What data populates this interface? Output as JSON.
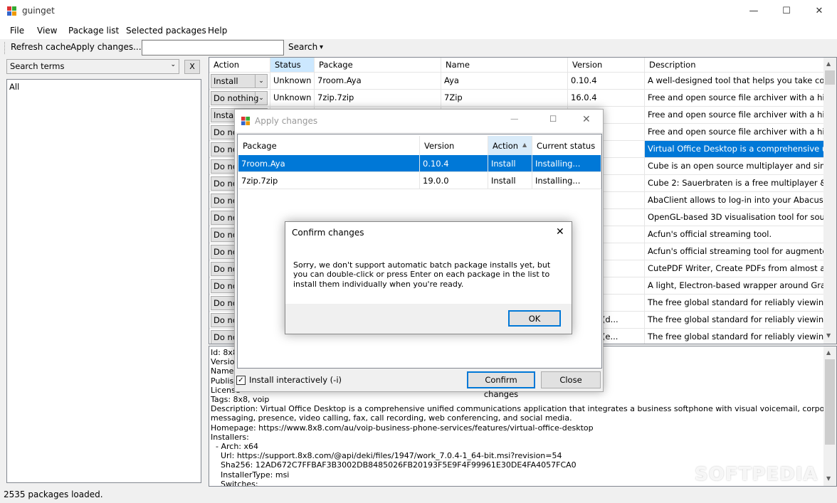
{
  "window": {
    "title": "guinget",
    "minimize": "—",
    "maximize": "☐",
    "close": "✕"
  },
  "menu": [
    "File",
    "View",
    "Package list",
    "Selected packages",
    "Help"
  ],
  "toolbar": {
    "refresh": "Refresh cache",
    "apply": "Apply changes...",
    "search_value": "",
    "search": "Search",
    "search_dropdown": "▾"
  },
  "left": {
    "search_terms": "Search terms",
    "clear": "X",
    "terms": [
      "All"
    ]
  },
  "grid": {
    "headers": [
      "Action",
      "Status",
      "Package",
      "Name",
      "Version",
      "Description"
    ],
    "rows": [
      {
        "action": "Install",
        "status": "Unknown",
        "package": "7room.Aya",
        "name": "Aya",
        "version": "0.10.4",
        "desc": "A well-designed tool that helps you take control o..."
      },
      {
        "action": "Do nothing",
        "status": "Unknown",
        "package": "7zip.7zip",
        "name": "7Zip",
        "version": "16.0.4",
        "desc": "Free and open source file archiver with a high co..."
      },
      {
        "action": "Install",
        "status": "",
        "package": "",
        "name": "",
        "version": "",
        "desc": "Free and open source file archiver with a high co..."
      },
      {
        "action": "Do not",
        "status": "",
        "package": "",
        "name": "",
        "version": "ha",
        "desc": "Free and open source file archiver with a high co..."
      },
      {
        "action": "Do not",
        "status": "",
        "package": "",
        "name": "",
        "version": "",
        "desc": "Virtual Office Desktop is a comprehensive unified..."
      },
      {
        "action": "Do not",
        "status": "",
        "package": "",
        "name": "",
        "version": "29",
        "desc": "Cube is an open source multiplayer and singlepla..."
      },
      {
        "action": "Do not",
        "status": "",
        "package": "",
        "name": "",
        "version": "04",
        "desc": "Cube 2: Sauerbraten is a free multiplayer & single..."
      },
      {
        "action": "Do not",
        "status": "",
        "package": "",
        "name": "",
        "version": "",
        "desc": "AbaClient allows to log-in into your Abacus Busin..."
      },
      {
        "action": "Do not",
        "status": "",
        "package": "",
        "name": "",
        "version": "",
        "desc": "OpenGL-based 3D visualisation tool for source c..."
      },
      {
        "action": "Do not",
        "status": "",
        "package": "",
        "name": "",
        "version": "",
        "desc": "Acfun's official streaming tool."
      },
      {
        "action": "Do not",
        "status": "",
        "package": "",
        "name": "",
        "version": "",
        "desc": "Acfun's official streaming tool for augmented realit..."
      },
      {
        "action": "Do not",
        "status": "",
        "package": "",
        "name": "",
        "version": "",
        "desc": "CutePDF Writer, Create PDFs from almost any ap..."
      },
      {
        "action": "Do not",
        "status": "",
        "package": "",
        "name": "",
        "version": "",
        "desc": "A light, Electron-based wrapper around GraphiQL."
      },
      {
        "action": "Do not",
        "status": "",
        "package": "",
        "name": "",
        "version": ".20063",
        "desc": "The free global standard for reliably viewing, printi..."
      },
      {
        "action": "Do not",
        "status": "",
        "package": "",
        "name": "",
        "version": ".20041 (d...",
        "desc": "The free global standard for reliably viewing, printi..."
      },
      {
        "action": "Do not",
        "status": "",
        "package": "",
        "name": "",
        "version": ".20041 (e...",
        "desc": "The free global standard for reliably viewing, printi..."
      }
    ],
    "selected_row": 4
  },
  "details": [
    "Id: 8x8",
    "Version",
    "Name:",
    "Publish",
    "License",
    "Tags: 8x8, voip",
    "Description: Virtual Office Desktop is a comprehensive unified communications application that integrates a business softphone with visual voicemail, corporate directory, instant",
    "messaging, presence, video calling, fax, call recording, web conferencing, and social media.",
    "Homepage: https://www.8x8.com/au/voip-business-phone-services/features/virtual-office-desktop",
    "Installers:",
    "  - Arch: x64",
    "    Url: https://support.8x8.com/@api/deki/files/1947/work_7.0.4-1_64-bit.msi?revision=54",
    "    Sha256: 12AD672C7FFBAF3B3002DB8485026FB20193F5E9F4F99961E30DE4FA4057FCA0",
    "    InstallerType: msi",
    "    Switches:"
  ],
  "status": "2535 packages loaded.",
  "watermark": "SOFTPEDIA",
  "apply": {
    "title": "Apply changes",
    "headers": [
      "Package",
      "Version",
      "Action",
      "Current status"
    ],
    "rows": [
      {
        "package": "7room.Aya",
        "version": "0.10.4",
        "action": "Install",
        "status": "Installing..."
      },
      {
        "package": "7zip.7zip",
        "version": "19.0.0",
        "action": "Install",
        "status": "Installing..."
      }
    ],
    "interactive_label": "Install interactively (-i)",
    "interactive_checked": true,
    "confirm": "Confirm changes",
    "close": "Close"
  },
  "confirm": {
    "title": "Confirm changes",
    "message": "Sorry, we don't support automatic batch package installs yet, but you can double-click or press Enter on each package in the list to install them individually when you're ready.",
    "ok": "OK"
  },
  "colors": {
    "accent": "#0078d7",
    "selected_header": "#cce8ff"
  }
}
